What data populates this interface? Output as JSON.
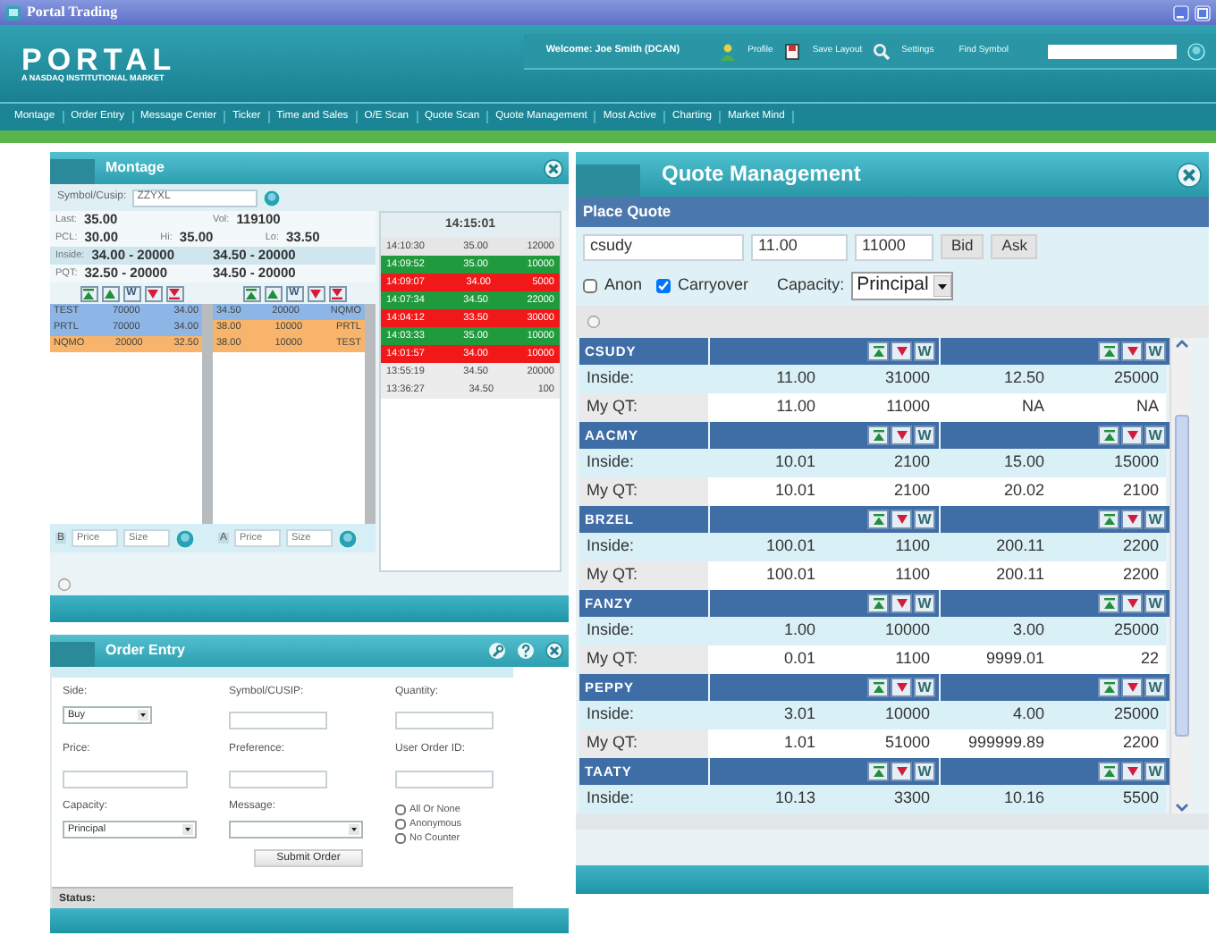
{
  "window": {
    "title": "Portal Trading"
  },
  "header": {
    "logo": "PORTAL",
    "tagline": "A NASDAQ INSTITUTIONAL MARKET",
    "welcome": "Welcome: Joe Smith (DCAN)",
    "links": [
      {
        "kind": "profile",
        "label": "Profile"
      },
      {
        "kind": "save",
        "label": "Save Layout"
      },
      {
        "kind": "settings",
        "label": "Settings"
      }
    ],
    "find_label": "Find Symbol"
  },
  "nav": [
    "Montage",
    "Order Entry",
    "Message Center",
    "Ticker",
    "Time and Sales",
    "O/E Scan",
    "Quote Scan",
    "Quote Management",
    "Most Active",
    "Charting",
    "Market Mind"
  ],
  "montage": {
    "title": "Montage",
    "symbol_label": "Symbol/Cusip:",
    "symbol": "ZZYXL",
    "summary": [
      {
        "highlighted": false,
        "cells": [
          {
            "label": "Last:",
            "value": "35.00"
          },
          {
            "label": "Vol:",
            "value": "119100"
          }
        ]
      },
      {
        "highlighted": false,
        "cells": [
          {
            "label": "PCL:",
            "value": "30.00"
          },
          {
            "label": "Hi:",
            "value": "35.00"
          },
          {
            "label": "Lo:",
            "value": "33.50"
          }
        ]
      },
      {
        "highlighted": true,
        "cells": [
          {
            "label": "Inside:",
            "value": "34.00 - 20000"
          },
          {
            "value": "34.50 - 20000"
          }
        ]
      },
      {
        "highlighted": false,
        "cells": [
          {
            "label": "PQT:",
            "value": "32.50 - 20000"
          },
          {
            "value": "34.50 - 20000"
          }
        ]
      }
    ],
    "books": [
      {
        "buttons": [
          {
            "kind": "top"
          },
          {
            "kind": "up"
          },
          {
            "kind": "text",
            "label": "W"
          },
          {
            "kind": "down"
          },
          {
            "kind": "bottom"
          }
        ],
        "rows": [
          {
            "cells": [
              "TEST",
              "70000",
              "34.00"
            ],
            "color": "#8db6e6"
          },
          {
            "cells": [
              "PRTL",
              "70000",
              "34.00"
            ],
            "color": "#8db6e6"
          },
          {
            "cells": [
              "NQMO",
              "20000",
              "32.50"
            ],
            "color": "#f7b46a"
          }
        ],
        "entry": {
          "side": "B",
          "price_placeholder": "Price",
          "size_placeholder": "Size"
        }
      },
      {
        "buttons": [
          {
            "kind": "top"
          },
          {
            "kind": "up"
          },
          {
            "kind": "text",
            "label": "W"
          },
          {
            "kind": "down"
          },
          {
            "kind": "bottom"
          }
        ],
        "rows": [
          {
            "cells": [
              "34.50",
              "20000",
              "NQMO"
            ],
            "color": "#8db6e6"
          },
          {
            "cells": [
              "38.00",
              "10000",
              "PRTL"
            ],
            "color": "#f7b46a"
          },
          {
            "cells": [
              "38.00",
              "10000",
              "TEST"
            ],
            "color": "#f7b46a"
          }
        ],
        "entry": {
          "side": "A",
          "price_placeholder": "Price",
          "size_placeholder": "Size"
        }
      }
    ],
    "time_and_sales": {
      "clock": "14:15:01",
      "trades": [
        {
          "time": "14:10:30",
          "price": "35.00",
          "size": "12000",
          "color": "#e6e6e6"
        },
        {
          "time": "14:09:52",
          "price": "35.00",
          "size": "10000",
          "color": "#1f9a3c"
        },
        {
          "time": "14:09:07",
          "price": "34.00",
          "size": "5000",
          "color": "#f01818"
        },
        {
          "time": "14:07:34",
          "price": "34.50",
          "size": "22000",
          "color": "#1f9a3c"
        },
        {
          "time": "14:04:12",
          "price": "33.50",
          "size": "30000",
          "color": "#f01818"
        },
        {
          "time": "14:03:33",
          "price": "35.00",
          "size": "10000",
          "color": "#1f9a3c"
        },
        {
          "time": "14:01:57",
          "price": "34.00",
          "size": "10000",
          "color": "#f01818"
        },
        {
          "time": "13:55:19",
          "price": "34.50",
          "size": "20000",
          "color": "#ececec"
        },
        {
          "time": "13:36:27",
          "price": "34.50",
          "size": "100",
          "color": "#ececec"
        }
      ]
    }
  },
  "order_entry": {
    "title": "Order Entry",
    "fields": [
      {
        "label": "Side:",
        "kind": "select",
        "value": "Buy"
      },
      {
        "label": "Symbol/CUSIP:",
        "kind": "input"
      },
      {
        "label": "Quantity:",
        "kind": "input"
      },
      {
        "label": "Price:",
        "kind": "input"
      },
      {
        "label": "Preference:",
        "kind": "input"
      },
      {
        "label": "User Order ID:",
        "kind": "input"
      },
      {
        "label": "Capacity:",
        "kind": "select",
        "value": "Principal"
      },
      {
        "label": "Message:",
        "kind": "select"
      }
    ],
    "options": [
      {
        "label": "All Or None",
        "checked": false
      },
      {
        "label": "Anonymous",
        "checked": false
      },
      {
        "label": "No Counter",
        "checked": false
      }
    ],
    "submit": "Submit Order",
    "status_label": "Status:"
  },
  "quote_management": {
    "title": "Quote Management",
    "section": "Place Quote",
    "symbol": "csudy",
    "price": "11.00",
    "size": "11000",
    "buttons": [
      "Bid",
      "Ask"
    ],
    "options": [
      {
        "label": "Anon",
        "checked": false
      },
      {
        "label": "Carryover",
        "checked": true
      }
    ],
    "capacity_label": "Capacity:",
    "capacity": "Principal",
    "quotes": [
      {
        "symbol": "CSUDY",
        "sides": [
          "W",
          "W"
        ],
        "rows": [
          {
            "kind": "market",
            "label": "Inside:",
            "values": [
              "11.00",
              "31000",
              "12.50",
              "25000"
            ]
          },
          {
            "kind": "own",
            "label": "My QT:",
            "values": [
              "11.00",
              "11000",
              "NA",
              "NA"
            ]
          }
        ]
      },
      {
        "symbol": "AACMY",
        "sides": [
          "W",
          "W"
        ],
        "rows": [
          {
            "kind": "market",
            "label": "Inside:",
            "values": [
              "10.01",
              "2100",
              "15.00",
              "15000"
            ]
          },
          {
            "kind": "own",
            "label": "My QT:",
            "values": [
              "10.01",
              "2100",
              "20.02",
              "2100"
            ]
          }
        ]
      },
      {
        "symbol": "BRZEL",
        "sides": [
          "W",
          "W"
        ],
        "rows": [
          {
            "kind": "market",
            "label": "Inside:",
            "values": [
              "100.01",
              "1100",
              "200.11",
              "2200"
            ]
          },
          {
            "kind": "own",
            "label": "My QT:",
            "values": [
              "100.01",
              "1100",
              "200.11",
              "2200"
            ]
          }
        ]
      },
      {
        "symbol": "FANZY",
        "sides": [
          "W",
          "W"
        ],
        "rows": [
          {
            "kind": "market",
            "label": "Inside:",
            "values": [
              "1.00",
              "10000",
              "3.00",
              "25000"
            ]
          },
          {
            "kind": "own",
            "label": "My QT:",
            "values": [
              "0.01",
              "1100",
              "9999.01",
              "22"
            ]
          }
        ]
      },
      {
        "symbol": "PEPPY",
        "sides": [
          "W",
          "W"
        ],
        "rows": [
          {
            "kind": "market",
            "label": "Inside:",
            "values": [
              "3.01",
              "10000",
              "4.00",
              "25000"
            ]
          },
          {
            "kind": "own",
            "label": "My QT:",
            "values": [
              "1.01",
              "51000",
              "999999.89",
              "2200"
            ]
          }
        ]
      },
      {
        "symbol": "TAATY",
        "sides": [
          "W",
          "W"
        ],
        "rows": [
          {
            "kind": "market",
            "label": "Inside:",
            "values": [
              "10.13",
              "3300",
              "10.16",
              "5500"
            ]
          }
        ]
      }
    ]
  }
}
